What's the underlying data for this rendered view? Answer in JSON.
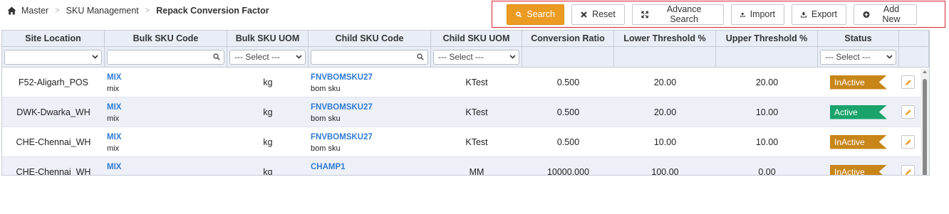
{
  "breadcrumb": {
    "items": [
      "Master",
      "SKU Management"
    ],
    "separator": ">",
    "current": "Repack Conversion Factor"
  },
  "toolbar": {
    "search_label": "Search",
    "reset_label": "Reset",
    "advanced_search_label": "Advance Search",
    "import_label": "Import",
    "export_label": "Export",
    "add_new_label": "Add New"
  },
  "colors": {
    "primary": "#ec9b22",
    "active": "#1aa36b",
    "inactive": "#c88619",
    "link": "#2f7bd3",
    "toolbar_border": "#d9232e"
  },
  "table": {
    "columns": [
      "Site Location",
      "Bulk SKU Code",
      "Bulk SKU UOM",
      "Child SKU Code",
      "Child SKU UOM",
      "Conversion Ratio",
      "Lower Threshold %",
      "Upper Threshold %",
      "Status"
    ],
    "filters": {
      "site_location": "",
      "bulk_sku_code": "",
      "bulk_sku_uom": "--- Select ---",
      "child_sku_code": "",
      "child_sku_uom": "--- Select ---",
      "status": "--- Select ---"
    },
    "rows": [
      {
        "site": "F52-Aligarh_POS",
        "bulk_code": "MIX",
        "bulk_desc": "mix",
        "bulk_uom": "kg",
        "child_code": "FNVBOMSKU27",
        "child_desc": "bom sku",
        "child_uom": "KTest",
        "ratio": "0.500",
        "lower": "20.00",
        "upper": "20.00",
        "status": "InActive"
      },
      {
        "site": "DWK-Dwarka_WH",
        "bulk_code": "MIX",
        "bulk_desc": "mix",
        "bulk_uom": "kg",
        "child_code": "FNVBOMSKU27",
        "child_desc": "bom sku",
        "child_uom": "KTest",
        "ratio": "0.500",
        "lower": "20.00",
        "upper": "10.00",
        "status": "Active"
      },
      {
        "site": "CHE-Chennai_WH",
        "bulk_code": "MIX",
        "bulk_desc": "mix",
        "bulk_uom": "kg",
        "child_code": "FNVBOMSKU27",
        "child_desc": "bom sku",
        "child_uom": "KTest",
        "ratio": "0.500",
        "lower": "10.00",
        "upper": "10.00",
        "status": "InActive"
      },
      {
        "site": "CHE-Chennai_WH",
        "bulk_code": "MIX",
        "bulk_desc": "",
        "bulk_uom": "kg",
        "child_code": "CHAMP1",
        "child_desc": "",
        "child_uom": "MM",
        "ratio": "10000.000",
        "lower": "100.00",
        "upper": "0.00",
        "status": "InActive"
      }
    ]
  }
}
